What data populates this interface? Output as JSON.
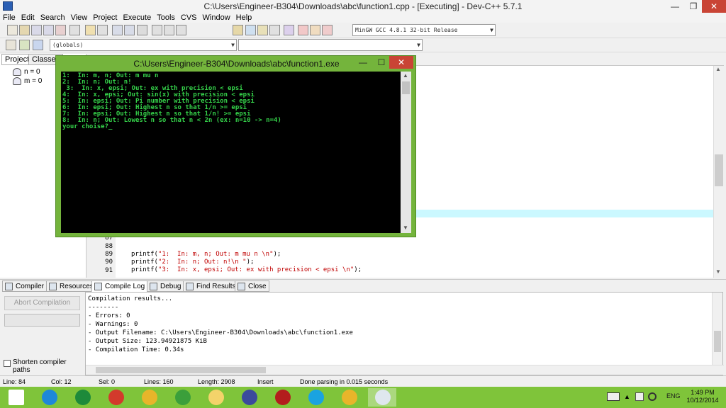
{
  "window": {
    "title": "C:\\Users\\Engineer-B304\\Downloads\\abc\\function1.cpp - [Executing] - Dev-C++ 5.7.1",
    "min_glyph": "—",
    "max_glyph": "❐",
    "close_glyph": "✕"
  },
  "menu": [
    "File",
    "Edit",
    "Search",
    "View",
    "Project",
    "Execute",
    "Tools",
    "CVS",
    "Window",
    "Help"
  ],
  "toolbar": {
    "compiler_select": "MinGW GCC 4.8.1 32-bit Release",
    "scope_select": "(globals)",
    "dropdown_glyph": "▼",
    "icons": [
      "new-file-icon",
      "open-icon",
      "save-icon",
      "save-all-icon",
      "close-file-icon",
      "print-icon",
      "undo-icon",
      "redo-icon",
      "find-icon",
      "replace-icon",
      "goto-line-icon",
      "indent-icon",
      "unindent-icon",
      "toggle-comment-icon",
      "compile-icon",
      "run-icon",
      "compile-run-icon",
      "rebuild-icon",
      "syntax-check-icon",
      "stop-icon",
      "chart-icon",
      "debug-icon"
    ]
  },
  "left_panel": {
    "tabs": [
      "Project",
      "Classes"
    ],
    "tree": [
      "n = 0",
      "m = 0"
    ]
  },
  "editor": {
    "line_numbers": [
      "87",
      "88",
      "89",
      "90",
      "91"
    ],
    "code_lines": [
      {
        "prefix": "printf(",
        "string": "\"1:  In: m, n; Out: m mu n \\n\"",
        "suffix": ");"
      },
      {
        "prefix": "printf(",
        "string": "\"2:  In: n; Out: n!\\n \"",
        "suffix": ");"
      },
      {
        "prefix": "printf(",
        "string": "\"3:  In: x, epsi; Out: ex with precision < epsi \\n\"",
        "suffix": ");"
      }
    ],
    "scroll_up": "▲",
    "scroll_down": "▼"
  },
  "console": {
    "title": "C:\\Users\\Engineer-B304\\Downloads\\abc\\function1.exe",
    "min_glyph": "—",
    "max_glyph": "☐",
    "close_glyph": "✕",
    "lines": [
      "1:  In: m, n; Out: m mu n",
      "2:  In: n; Out: n!",
      " 3:  In: x, epsi; Out: ex with precision < epsi",
      "4:  In: x, epsi; Out: sin(x) with precision < epsi",
      "5:  In: epsi; Out: Pi number with precision < epsi",
      "6:  In: epsi; Out: Highest n so that 1/n >= epsi",
      "7:  In: epsi; Out: Highest n so that 1/n! >= epsi",
      "8:  In: n; Out: Lowest n so that n < 2n (ex: n=10 -> n=4)",
      "your choise?_"
    ],
    "scroll_up": "▲",
    "scroll_down": "▼"
  },
  "bottom_tabs": [
    "Compiler",
    "Resources",
    "Compile Log",
    "Debug",
    "Find Results",
    "Close"
  ],
  "bottom_left": {
    "abort_label": "Abort Compilation",
    "shorten_label": "Shorten compiler paths"
  },
  "compile_log": [
    "Compilation results...",
    "--------",
    "- Errors: 0",
    "- Warnings: 0",
    "- Output Filename: C:\\Users\\Engineer-B304\\Downloads\\abc\\function1.exe",
    "- Output Size: 123.94921875 KiB",
    "- Compilation Time: 0.34s"
  ],
  "status": {
    "line": "Line:   84",
    "col": "Col:   12",
    "sel": "Sel:   0",
    "lines": "Lines:   160",
    "length": "Length:  2908",
    "mode": "Insert",
    "parse": "Done parsing in 0.015 seconds"
  },
  "taskbar": {
    "lang": "ENG",
    "time": "1:49 PM",
    "date": "10/12/2014",
    "apps": [
      {
        "name": "windows-start",
        "color": "#ffffff"
      },
      {
        "name": "internet-explorer",
        "color": "#1e88d8"
      },
      {
        "name": "store",
        "color": "#1d8a3a"
      },
      {
        "name": "paint",
        "color": "#d33a2c"
      },
      {
        "name": "chrome",
        "color": "#e8b52a"
      },
      {
        "name": "tool",
        "color": "#3b9f3b"
      },
      {
        "name": "folder",
        "color": "#f3d36a"
      },
      {
        "name": "dev-cpp",
        "color": "#3b4a9c"
      },
      {
        "name": "game",
        "color": "#b31d1d"
      },
      {
        "name": "skype",
        "color": "#1aa3e0"
      },
      {
        "name": "chrome-2",
        "color": "#e8b52a"
      },
      {
        "name": "console-window",
        "color": "#dfe7ee"
      }
    ]
  }
}
